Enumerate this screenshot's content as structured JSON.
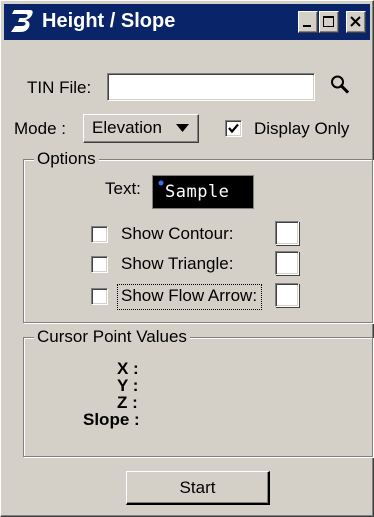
{
  "window": {
    "title": "Height / Slope"
  },
  "tin_file": {
    "label": "TIN File:",
    "value": ""
  },
  "mode": {
    "label": "Mode :",
    "selected": "Elevation",
    "display_only_label": "Display Only",
    "display_only_checked": true
  },
  "options": {
    "group_title": "Options",
    "text_label": "Text:",
    "sample_text": "Sample",
    "items": [
      {
        "label": "Show Contour:",
        "checked": false
      },
      {
        "label": "Show Triangle:",
        "checked": false
      },
      {
        "label": "Show Flow Arrow:",
        "checked": false
      }
    ]
  },
  "cursor": {
    "group_title": "Cursor Point Values",
    "x_label": "X :",
    "y_label": "Y :",
    "z_label": "Z :",
    "slope_label": "Slope :"
  },
  "actions": {
    "start_label": "Start"
  },
  "colors": {
    "titlebar": "#0a246a",
    "face": "#d4d0c8",
    "sample_bg": "#000000",
    "sample_dot": "#3a6ff7"
  },
  "icons": {
    "app": "bentley-b-icon",
    "browse": "magnifier-icon",
    "dropdown": "triangle-down-icon"
  }
}
